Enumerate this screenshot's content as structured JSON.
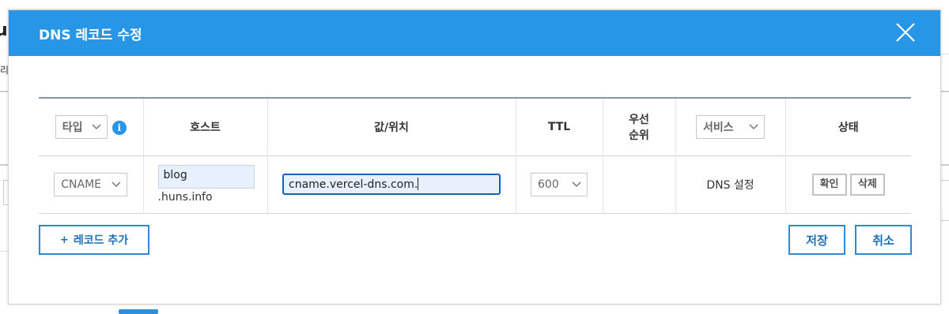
{
  "background": {
    "title_fragment": "u",
    "label_fragment": "리"
  },
  "modal": {
    "title": "DNS 레코드 수정",
    "close_icon": "close-icon"
  },
  "table": {
    "headers": {
      "type_select": "타입",
      "type_info_icon": "i",
      "host": "호스트",
      "value": "값/위치",
      "ttl": "TTL",
      "priority_line1": "우선",
      "priority_line2": "순위",
      "service_select": "서비스",
      "status": "상태"
    },
    "row": {
      "type": "CNAME",
      "host_value": "blog",
      "host_suffix": ".huns.info",
      "value": "cname.vercel-dns.com.",
      "ttl": "600",
      "priority": "",
      "service": "DNS 설정",
      "confirm_button": "확인",
      "delete_button": "삭제"
    }
  },
  "footer": {
    "add_record_plus": "+",
    "add_record_label": "레코드 추가",
    "save_button": "저장",
    "cancel_button": "취소"
  },
  "colors": {
    "header_bg": "#2896e6",
    "accent_border": "#2d8ad6",
    "focus_border": "#1762b8",
    "autofill_bg": "#e8f0fe"
  }
}
